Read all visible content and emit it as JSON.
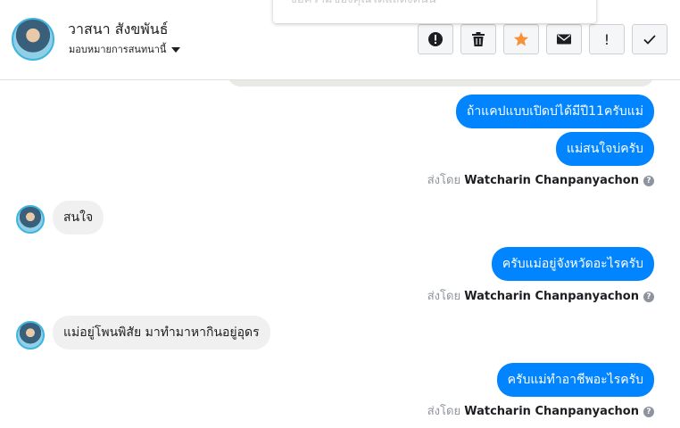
{
  "header": {
    "name": "วาสนา สังขพันธ์",
    "subtitle": "มอบหมายการสนทนานี้",
    "popup_text": "ข้อความของคุณได้แสดงต้นนี้"
  },
  "actions": [
    {
      "icon": "alert-circle-icon"
    },
    {
      "icon": "trash-icon"
    },
    {
      "icon": "star-icon"
    },
    {
      "icon": "envelope-icon"
    },
    {
      "label": "!"
    },
    {
      "icon": "checkmark-icon"
    }
  ],
  "colors": {
    "accent": "#0084ff",
    "star": "#f7923b",
    "incoming": "#f1f0f0"
  },
  "messages": {
    "m1": "ถ้าแคปแบบเปิดบ่ได้มีปี11ครับแม่",
    "m2": "แม่สนใจบ่ครับ",
    "m3": "สนใจ",
    "m4": "ครับแม่อยู่จังหวัดอะไรครับ",
    "m5": "แม่อยู่โพนพิสัย มาทำมาหากินอยู่อุดร",
    "m6": "ครับแม่ทำอาชีพอะไรครับ"
  },
  "sent_by": {
    "prefix": "ส่งโดย",
    "sender": "Watcharin Chanpanyachon",
    "help": "?"
  }
}
